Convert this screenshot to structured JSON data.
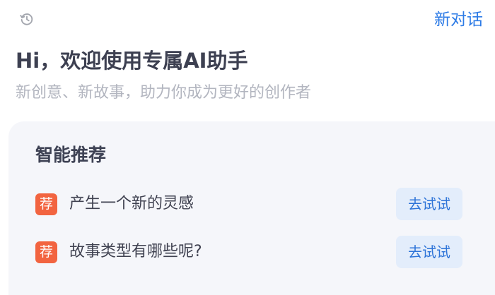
{
  "header": {
    "history_icon": "history-clock-icon",
    "new_chat_label": "新对话"
  },
  "welcome": {
    "title": "Hi，欢迎使用专属AI助手",
    "subtitle": "新创意、新故事，助力你成为更好的创作者"
  },
  "recommendations": {
    "title": "智能推荐",
    "items": [
      {
        "badge": "荐",
        "text": "产生一个新的灵感",
        "button": "去试试"
      },
      {
        "badge": "荐",
        "text": "故事类型有哪些呢?",
        "button": "去试试"
      }
    ]
  },
  "colors": {
    "accent": "#2d7be6",
    "badge": "#f26440",
    "card_background": "#f5f6fa",
    "button_background": "#e3edfb"
  }
}
